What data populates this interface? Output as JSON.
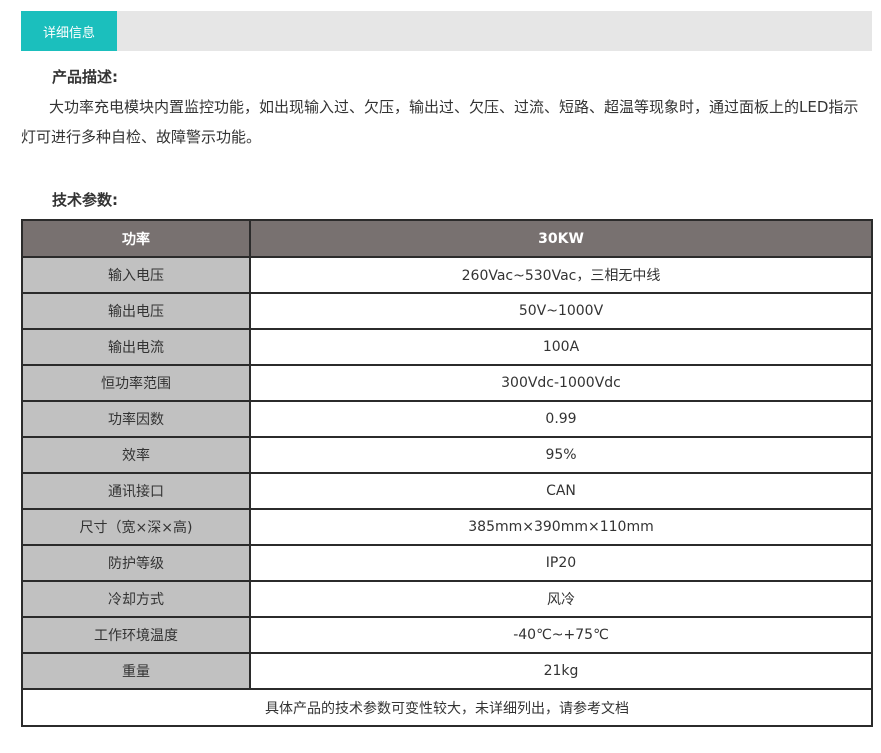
{
  "tab": {
    "label": "详细信息"
  },
  "description": {
    "heading": "产品描述:",
    "text": "大功率充电模块内置监控功能，如出现输入过、欠压，输出过、欠压、过流、短路、超温等现象时，通过面板上的LED指示灯可进行多种自检、故障警示功能。"
  },
  "specs": {
    "heading": "技术参数:",
    "header": {
      "label": "功率",
      "value": "30KW"
    },
    "rows": [
      {
        "label": "输入电压",
        "value": "260Vac~530Vac，三相无中线"
      },
      {
        "label": "输出电压",
        "value": "50V~1000V"
      },
      {
        "label": "输出电流",
        "value": "100A"
      },
      {
        "label": "恒功率范围",
        "value": "300Vdc-1000Vdc"
      },
      {
        "label": "功率因数",
        "value": "0.99"
      },
      {
        "label": "效率",
        "value": "95%"
      },
      {
        "label": "通讯接口",
        "value": "CAN"
      },
      {
        "label": "尺寸（宽×深×高)",
        "value": "385mm×390mm×110mm"
      },
      {
        "label": "防护等级",
        "value": "IP20"
      },
      {
        "label": "冷却方式",
        "value": "风冷"
      },
      {
        "label": "工作环境温度",
        "value": "-40℃~+75℃"
      },
      {
        "label": "重量",
        "value": "21kg"
      }
    ],
    "footnote": "具体产品的技术参数可变性较大，未详细列出，请参考文档"
  }
}
